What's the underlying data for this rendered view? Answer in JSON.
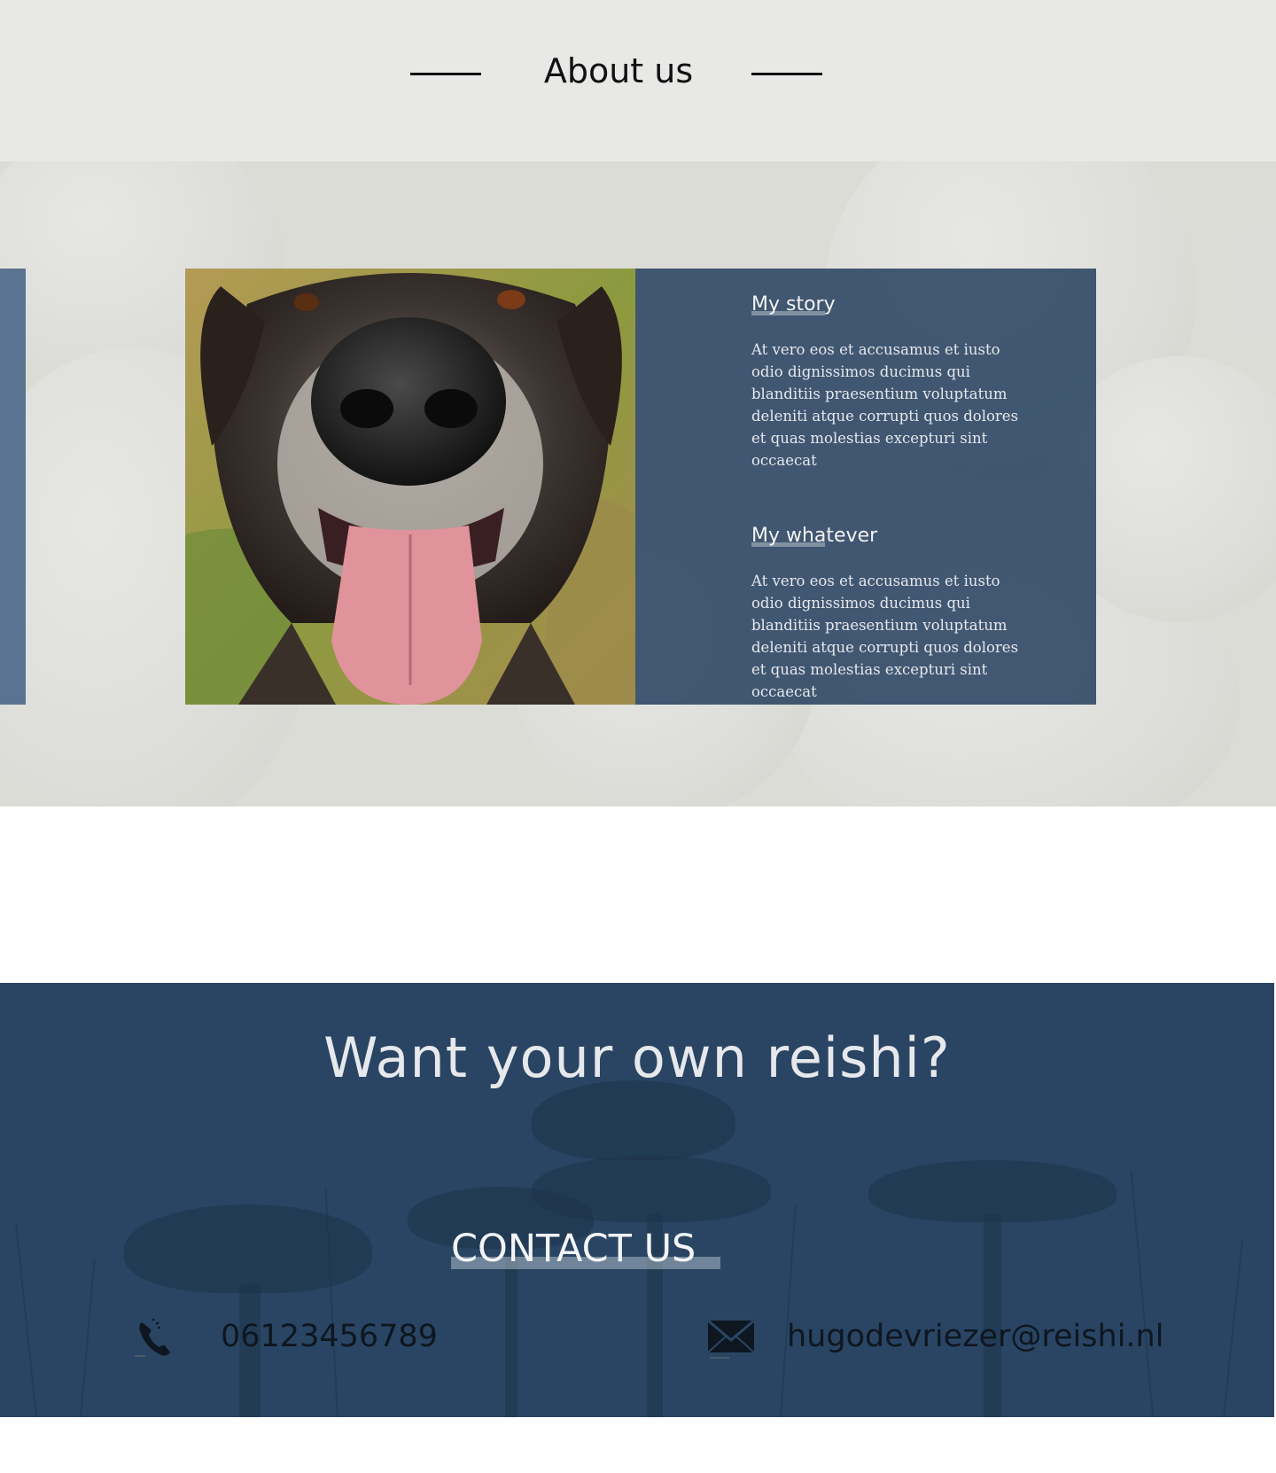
{
  "about": {
    "title": "About us"
  },
  "story": {
    "blocks": [
      {
        "title": "My story",
        "text": "At vero eos et accusamus et iusto odio dignissimos ducimus qui blanditiis praesentium voluptatum deleniti atque corrupti quos dolores et quas molestias excepturi sint occaecat"
      },
      {
        "title": "My whatever",
        "text": "At vero eos et accusamus et iusto odio dignissimos ducimus qui blanditiis praesentium voluptatum deleniti atque corrupti quos dolores et quas molestias excepturi sint occaecat"
      }
    ]
  },
  "cta": {
    "title": "Want your own reishi?",
    "contact_heading": "CONTACT US",
    "phone": "06123456789",
    "email": "hugodevriezer@reishi.nl"
  },
  "colors": {
    "header_bg": "#e8e9e6",
    "panel_blue": "#264060",
    "cta_bg": "#2a4664",
    "text_dark": "#111111"
  },
  "icons": {
    "phone": "phone-icon",
    "mail": "mail-icon"
  }
}
